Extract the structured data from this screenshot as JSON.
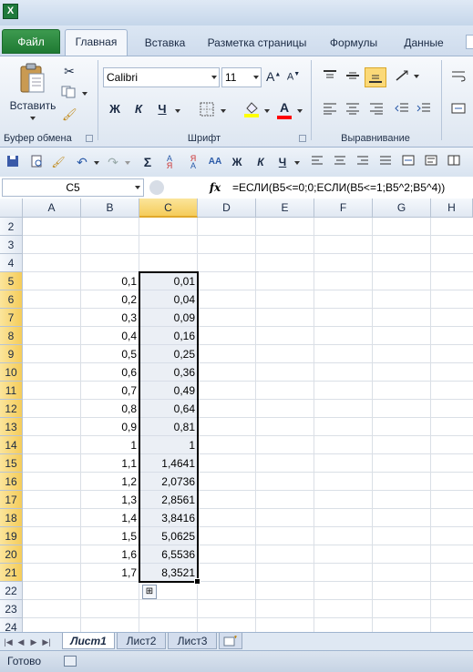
{
  "ribbon_tabs": {
    "file": "Файл",
    "home": "Главная",
    "insert": "Вставка",
    "layout": "Разметка страницы",
    "formulas": "Формулы",
    "data": "Данные"
  },
  "clipboard": {
    "paste_label": "Вставить",
    "group_label": "Буфер обмена"
  },
  "font": {
    "name": "Calibri",
    "size": "11",
    "bold": "Ж",
    "italic": "К",
    "underline": "Ч",
    "group_label": "Шрифт"
  },
  "alignment": {
    "group_label": "Выравнивание"
  },
  "qat": {
    "sum": "Σ",
    "bold": "Ж",
    "italic": "К",
    "underline": "Ч"
  },
  "formula_bar": {
    "name_box": "C5",
    "fx": "fx",
    "formula": "=ЕСЛИ(B5<=0;0;ЕСЛИ(B5<=1;B5^2;B5^4))"
  },
  "columns": [
    "A",
    "B",
    "C",
    "D",
    "E",
    "F",
    "G",
    "H"
  ],
  "selected_column": "C",
  "rows": [
    {
      "num": "2",
      "b": "",
      "c": ""
    },
    {
      "num": "3",
      "b": "",
      "c": ""
    },
    {
      "num": "4",
      "b": "",
      "c": ""
    },
    {
      "num": "5",
      "b": "0,1",
      "c": "0,01"
    },
    {
      "num": "6",
      "b": "0,2",
      "c": "0,04"
    },
    {
      "num": "7",
      "b": "0,3",
      "c": "0,09"
    },
    {
      "num": "8",
      "b": "0,4",
      "c": "0,16"
    },
    {
      "num": "9",
      "b": "0,5",
      "c": "0,25"
    },
    {
      "num": "10",
      "b": "0,6",
      "c": "0,36"
    },
    {
      "num": "11",
      "b": "0,7",
      "c": "0,49"
    },
    {
      "num": "12",
      "b": "0,8",
      "c": "0,64"
    },
    {
      "num": "13",
      "b": "0,9",
      "c": "0,81"
    },
    {
      "num": "14",
      "b": "1",
      "c": "1"
    },
    {
      "num": "15",
      "b": "1,1",
      "c": "1,4641"
    },
    {
      "num": "16",
      "b": "1,2",
      "c": "2,0736"
    },
    {
      "num": "17",
      "b": "1,3",
      "c": "2,8561"
    },
    {
      "num": "18",
      "b": "1,4",
      "c": "3,8416"
    },
    {
      "num": "19",
      "b": "1,5",
      "c": "5,0625"
    },
    {
      "num": "20",
      "b": "1,6",
      "c": "6,5536"
    },
    {
      "num": "21",
      "b": "1,7",
      "c": "8,3521"
    },
    {
      "num": "22",
      "b": "",
      "c": ""
    },
    {
      "num": "23",
      "b": "",
      "c": ""
    },
    {
      "num": "24",
      "b": "",
      "c": ""
    }
  ],
  "sheet_tabs": [
    "Лист1",
    "Лист2",
    "Лист3"
  ],
  "active_sheet": "Лист1",
  "status": "Готово",
  "colors": {
    "file_tab": "#2a8a3e",
    "selection_header": "#f5cc5a",
    "font_highlight": "#ffff00",
    "font_color": "#ff0000"
  }
}
